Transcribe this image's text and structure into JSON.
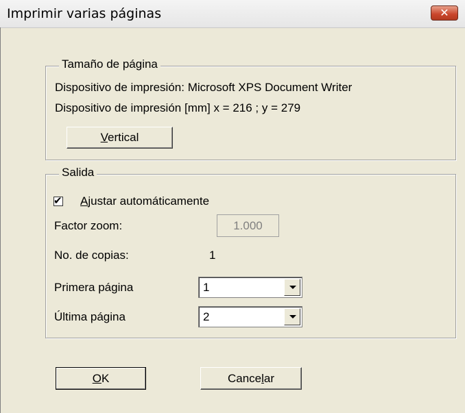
{
  "window": {
    "title": "Imprimir varias páginas"
  },
  "page_size": {
    "legend": "Tamaño de página",
    "device_line": "Dispositivo de impresión: Microsoft XPS Document Writer",
    "device_mm_line": "Dispositivo de impresión [mm]  x = 216 ; y = 279",
    "orientation_button": {
      "label_mnemonic": "V",
      "label_rest": "ertical"
    }
  },
  "output": {
    "legend": "Salida",
    "auto_fit": {
      "checked": true,
      "label_mnemonic": "A",
      "label_rest": "justar automáticamente"
    },
    "zoom_factor": {
      "label": "Factor zoom:",
      "value": "1.000"
    },
    "copies": {
      "label": "No. de copias:",
      "value": "1"
    },
    "first_page": {
      "label": "Primera página",
      "value": "1"
    },
    "last_page": {
      "label": "Última página",
      "value": "2"
    }
  },
  "buttons": {
    "ok": {
      "label_mnemonic": "O",
      "label_rest": "K"
    },
    "cancel": {
      "label_pre": "Cance",
      "label_mnemonic": "l",
      "label_rest": "ar"
    }
  },
  "icons": {
    "close": "close-icon",
    "dropdown": "chevron-down-icon",
    "check": "checkmark-icon"
  },
  "colors": {
    "dialog_bg": "#ece9d8",
    "close_button": "#c9452b"
  }
}
